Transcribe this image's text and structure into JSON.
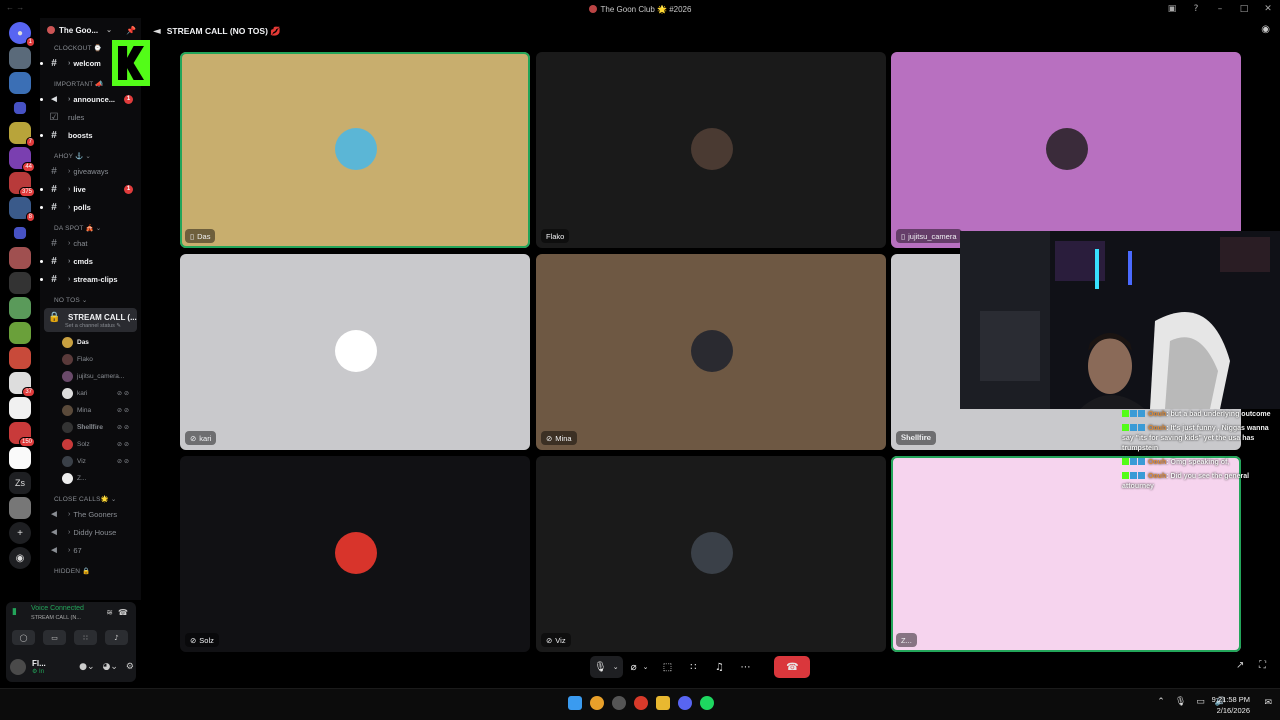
{
  "window": {
    "title": "The Goon Club 🌟 #2026",
    "controls": [
      "▣",
      "?",
      "–",
      "□",
      "✕"
    ]
  },
  "server_rail": {
    "badges": [
      "1",
      "7",
      "44",
      "375",
      "8",
      "37",
      "150"
    ],
    "text_server": "Zs"
  },
  "server": {
    "name": "The Goo...",
    "chevron": "⌄",
    "pin_icon": "📌"
  },
  "channels": {
    "categories": {
      "clockout": "CLOCKOUT ⌚",
      "important": "IMPORTANT 📣",
      "ahoy": "AHOY ⚓ ⌄",
      "da_spot": "DA SPOT 🎪 ⌄",
      "no_tos": "NO TOS ⌄",
      "close_calls": "CLOSE CALLS🌟 ⌄",
      "hidden": "HIDDEN 🔒"
    },
    "welcome": "welcom",
    "announcements": "announce...",
    "announcements_unread": "1",
    "rules": "rules",
    "boosts": "boosts",
    "giveaways": "giveaways",
    "live": "live",
    "live_unread": "1",
    "polls": "polls",
    "chat": "chat",
    "cmds": "cmds",
    "stream_clips": "stream-clips",
    "stream_call": "STREAM CALL (...",
    "stream_call_status": "Set a channel status ✎",
    "voice_the_gooners": "The Gooners",
    "voice_diddy_house": "Diddy House",
    "voice_67": "67"
  },
  "voice_users": [
    {
      "name": "Das",
      "icons": ""
    },
    {
      "name": "Flako",
      "icons": ""
    },
    {
      "name": "jujitsu_camera...",
      "icons": ""
    },
    {
      "name": "kari",
      "icons": "⊘ ⊘"
    },
    {
      "name": "Mina",
      "icons": "⊘ ⊘"
    },
    {
      "name": "𝐒𝐡𝐞𝐥𝐥𝐟𝐢𝐫𝐞",
      "icons": "⊘ ⊘"
    },
    {
      "name": "Solz",
      "icons": "⊘ ⊘"
    },
    {
      "name": "Viz",
      "icons": "⊘ ⊘"
    },
    {
      "name": "Z...",
      "icons": ""
    }
  ],
  "voice_panel": {
    "status": "Voice Connected",
    "channel": "STREAM CALL (N...",
    "user_name": "Fl...",
    "user_sub": "⚙ In"
  },
  "header": {
    "channel_name": "STREAM CALL (NO TOS) 💋"
  },
  "tiles": [
    {
      "name": "Das",
      "prefix": "▯",
      "bg": "#c8ae6e",
      "av": "#5bb6d6"
    },
    {
      "name": "Flako",
      "prefix": "",
      "bg": "#1a1a1a",
      "av": "#4a3a32"
    },
    {
      "name": "jujitsu_camera",
      "prefix": "▯",
      "bg": "#b870c0",
      "av": "#3a2b3a"
    },
    {
      "name": "kari",
      "prefix": "⊘",
      "bg": "#c9c9cc",
      "av": "#ffffff"
    },
    {
      "name": "Mina",
      "prefix": "⊘",
      "bg": "#6e5843",
      "av": "#2a2a30"
    },
    {
      "name": "𝐒𝐡𝐞𝐥𝐥𝐟𝐢𝐫𝐞",
      "prefix": "",
      "bg": "#c9c9cc",
      "av": "#c9c9cc"
    },
    {
      "name": "Solz",
      "prefix": "⊘",
      "bg": "#111114",
      "av": "#d8342b"
    },
    {
      "name": "Viz",
      "prefix": "⊘",
      "bg": "#1a1a1a",
      "av": "#3a4048"
    },
    {
      "name": "Z...",
      "prefix": "",
      "bg": "#f6d4ee",
      "av": "#f6d4ee"
    }
  ],
  "chat_overlay": [
    {
      "user": "Oouh",
      "text": ": but a bad underlying outcome"
    },
    {
      "user": "Oouh",
      "text": ": It's just funny , Niggas wanna say \"its for saving kids\" yet the usa has trumpstein"
    },
    {
      "user": "Oouh",
      "text": ": Omg speaking of,"
    },
    {
      "user": "Oouh",
      "text": ": Did you see the general attourney"
    }
  ],
  "call_controls": {
    "mic": "🎙",
    "camera": "⌀",
    "share": "⬚",
    "activities": "∷",
    "soundboard": "♫",
    "more": "⋯",
    "end": "☎",
    "chevron": "⌄"
  },
  "taskbar": {
    "time": "9:21:58 PM",
    "date": "2/16/2026",
    "tray": [
      "⌃",
      "🎙",
      "▭",
      "🔊"
    ]
  },
  "colors": {
    "speaking": "#23a55a",
    "end_call": "#da373c",
    "kick_green": "#53fc18"
  }
}
